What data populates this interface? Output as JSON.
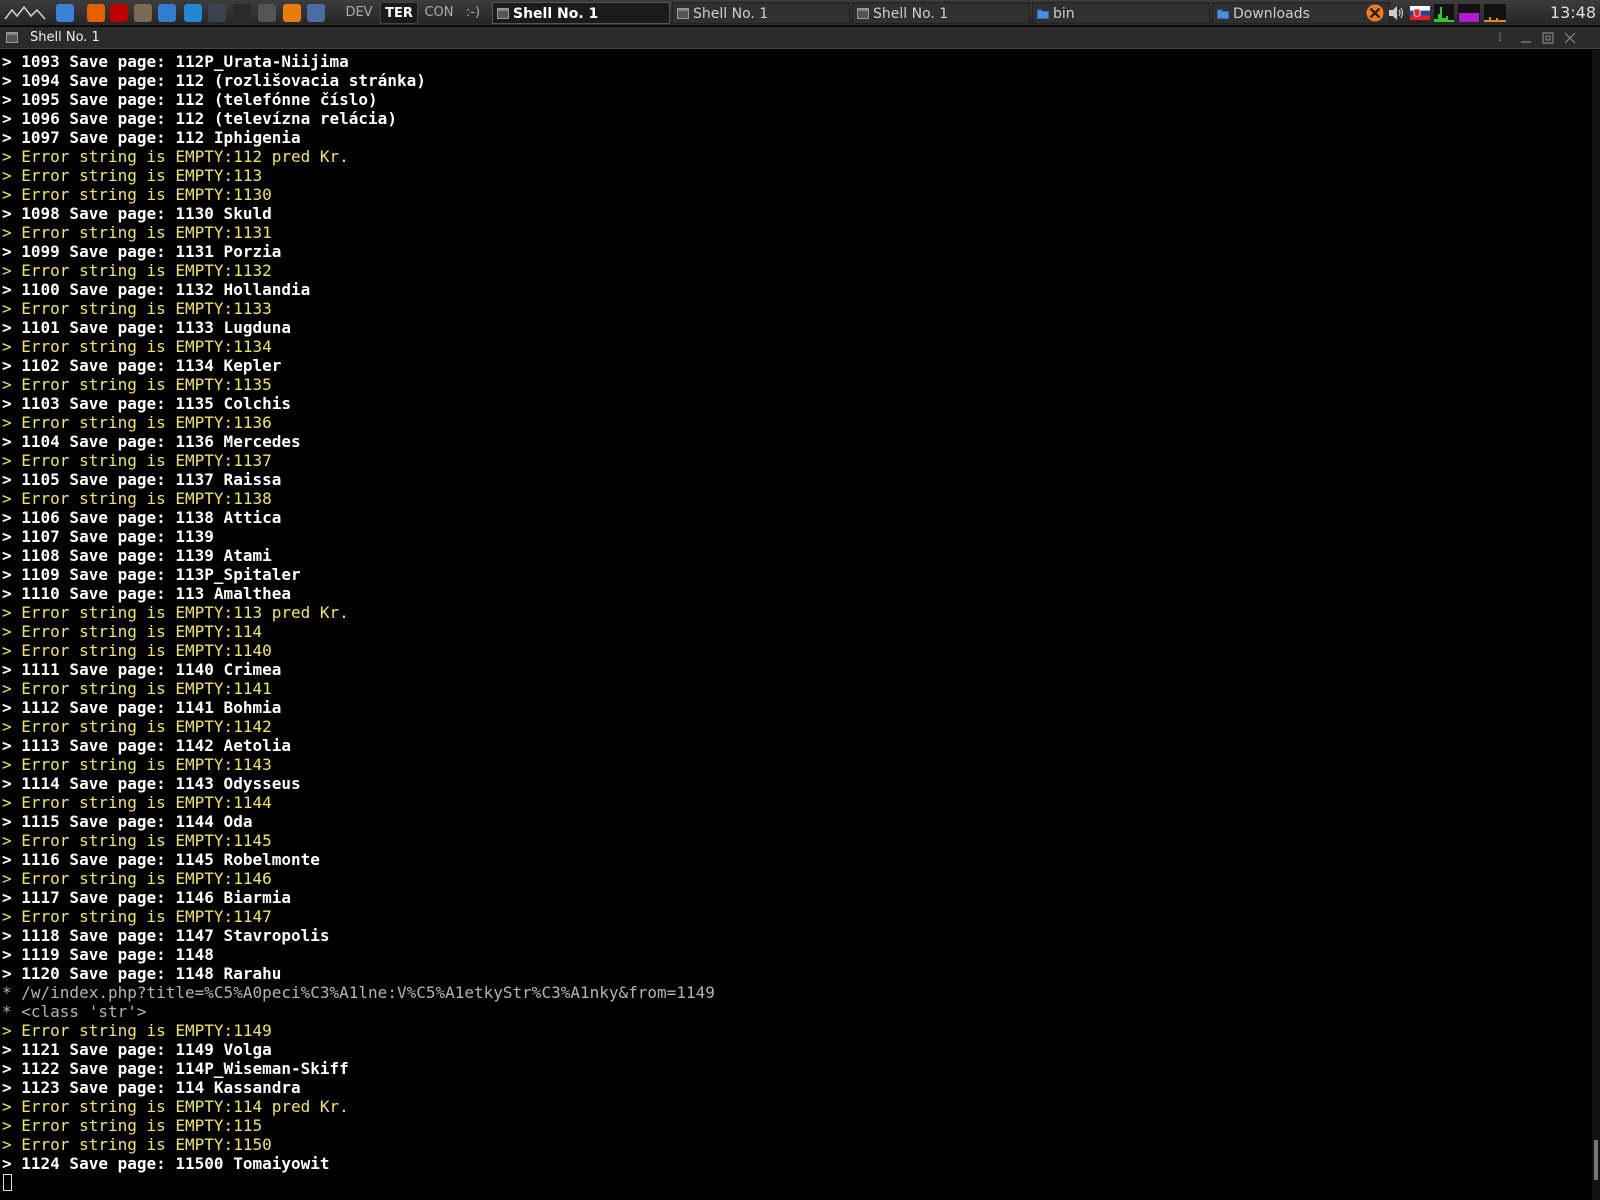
{
  "panel": {
    "workspaces": [
      {
        "label": "DEV",
        "active": false
      },
      {
        "label": "TER",
        "active": true
      },
      {
        "label": "CON",
        "active": false
      },
      {
        "label": ":-)",
        "active": false
      }
    ],
    "launchers": [
      {
        "icon": "network-icon",
        "color": "#3b82d6"
      },
      {
        "icon": "firefox-icon",
        "color": "#e66000"
      },
      {
        "icon": "filezilla-icon",
        "color": "#bf0000"
      },
      {
        "icon": "gimp-icon",
        "color": "#7a6a55"
      },
      {
        "icon": "app-window-icon",
        "color": "#2f7fd0"
      },
      {
        "icon": "vscode-icon",
        "color": "#1f8ad2"
      },
      {
        "icon": "terminal-app-icon",
        "color": "#3a4450"
      },
      {
        "icon": "inkscape-icon",
        "color": "#2a2a2a"
      },
      {
        "icon": "game-icon",
        "color": "#555555"
      },
      {
        "icon": "blender-icon",
        "color": "#e87d0d"
      },
      {
        "icon": "calculator-icon",
        "color": "#4a6fa5"
      }
    ],
    "tasks": [
      {
        "label": "Shell No. 1",
        "icon": "terminal-icon",
        "active": true
      },
      {
        "label": "Shell No. 1",
        "icon": "terminal-icon",
        "active": false
      },
      {
        "label": "Shell No. 1",
        "icon": "terminal-icon",
        "active": false
      },
      {
        "label": "bin",
        "icon": "folder-icon",
        "active": false
      },
      {
        "label": "Downloads",
        "icon": "folder-icon",
        "active": false
      }
    ],
    "tray": [
      "xampp-icon",
      "volume-icon",
      "slovak-flag-icon",
      "network-monitor-icon",
      "cpu-monitor-icon",
      "memory-monitor-icon"
    ],
    "clock": "13:48"
  },
  "window": {
    "title": "Shell No. 1"
  },
  "terminal": {
    "lines": [
      {
        "type": "save",
        "text": "> 1093 Save page: 112P_Urata-Niijima"
      },
      {
        "type": "save",
        "text": "> 1094 Save page: 112 (rozlišovacia stránka)"
      },
      {
        "type": "save",
        "text": "> 1095 Save page: 112 (telefónne číslo)"
      },
      {
        "type": "save",
        "text": "> 1096 Save page: 112 (televízna relácia)"
      },
      {
        "type": "save",
        "text": "> 1097 Save page: 112 Iphigenia"
      },
      {
        "type": "error",
        "text": "> Error string is EMPTY:112 pred Kr."
      },
      {
        "type": "error",
        "text": "> Error string is EMPTY:113"
      },
      {
        "type": "error",
        "text": "> Error string is EMPTY:1130"
      },
      {
        "type": "save",
        "text": "> 1098 Save page: 1130 Skuld"
      },
      {
        "type": "error",
        "text": "> Error string is EMPTY:1131"
      },
      {
        "type": "save",
        "text": "> 1099 Save page: 1131 Porzia"
      },
      {
        "type": "error",
        "text": "> Error string is EMPTY:1132"
      },
      {
        "type": "save",
        "text": "> 1100 Save page: 1132 Hollandia"
      },
      {
        "type": "error",
        "text": "> Error string is EMPTY:1133"
      },
      {
        "type": "save",
        "text": "> 1101 Save page: 1133 Lugduna"
      },
      {
        "type": "error",
        "text": "> Error string is EMPTY:1134"
      },
      {
        "type": "save",
        "text": "> 1102 Save page: 1134 Kepler"
      },
      {
        "type": "error",
        "text": "> Error string is EMPTY:1135"
      },
      {
        "type": "save",
        "text": "> 1103 Save page: 1135 Colchis"
      },
      {
        "type": "error",
        "text": "> Error string is EMPTY:1136"
      },
      {
        "type": "save",
        "text": "> 1104 Save page: 1136 Mercedes"
      },
      {
        "type": "error",
        "text": "> Error string is EMPTY:1137"
      },
      {
        "type": "save",
        "text": "> 1105 Save page: 1137 Raissa"
      },
      {
        "type": "error",
        "text": "> Error string is EMPTY:1138"
      },
      {
        "type": "save",
        "text": "> 1106 Save page: 1138 Attica"
      },
      {
        "type": "save",
        "text": "> 1107 Save page: 1139"
      },
      {
        "type": "save",
        "text": "> 1108 Save page: 1139 Atami"
      },
      {
        "type": "save",
        "text": "> 1109 Save page: 113P_Spitaler"
      },
      {
        "type": "save",
        "text": "> 1110 Save page: 113 Amalthea"
      },
      {
        "type": "error",
        "text": "> Error string is EMPTY:113 pred Kr."
      },
      {
        "type": "error",
        "text": "> Error string is EMPTY:114"
      },
      {
        "type": "error",
        "text": "> Error string is EMPTY:1140"
      },
      {
        "type": "save",
        "text": "> 1111 Save page: 1140 Crimea"
      },
      {
        "type": "error",
        "text": "> Error string is EMPTY:1141"
      },
      {
        "type": "save",
        "text": "> 1112 Save page: 1141 Bohmia"
      },
      {
        "type": "error",
        "text": "> Error string is EMPTY:1142"
      },
      {
        "type": "save",
        "text": "> 1113 Save page: 1142 Aetolia"
      },
      {
        "type": "error",
        "text": "> Error string is EMPTY:1143"
      },
      {
        "type": "save",
        "text": "> 1114 Save page: 1143 Odysseus"
      },
      {
        "type": "error",
        "text": "> Error string is EMPTY:1144"
      },
      {
        "type": "save",
        "text": "> 1115 Save page: 1144 Oda"
      },
      {
        "type": "error",
        "text": "> Error string is EMPTY:1145"
      },
      {
        "type": "save",
        "text": "> 1116 Save page: 1145 Robelmonte"
      },
      {
        "type": "error",
        "text": "> Error string is EMPTY:1146"
      },
      {
        "type": "save",
        "text": "> 1117 Save page: 1146 Biarmia"
      },
      {
        "type": "error",
        "text": "> Error string is EMPTY:1147"
      },
      {
        "type": "save",
        "text": "> 1118 Save page: 1147 Stavropolis"
      },
      {
        "type": "save",
        "text": "> 1119 Save page: 1148"
      },
      {
        "type": "save",
        "text": "> 1120 Save page: 1148 Rarahu"
      },
      {
        "type": "info",
        "text": "* /w/index.php?title=%C5%A0peci%C3%A1lne:V%C5%A1etkyStr%C3%A1nky&from=1149"
      },
      {
        "type": "info",
        "text": "* <class 'str'>"
      },
      {
        "type": "error",
        "text": "> Error string is EMPTY:1149"
      },
      {
        "type": "save",
        "text": "> 1121 Save page: 1149 Volga"
      },
      {
        "type": "save",
        "text": "> 1122 Save page: 114P_Wiseman-Skiff"
      },
      {
        "type": "save",
        "text": "> 1123 Save page: 114 Kassandra"
      },
      {
        "type": "error",
        "text": "> Error string is EMPTY:114 pred Kr."
      },
      {
        "type": "error",
        "text": "> Error string is EMPTY:115"
      },
      {
        "type": "error",
        "text": "> Error string is EMPTY:1150"
      },
      {
        "type": "save",
        "text": "> 1124 Save page: 11500 Tomaiyowit"
      }
    ]
  }
}
